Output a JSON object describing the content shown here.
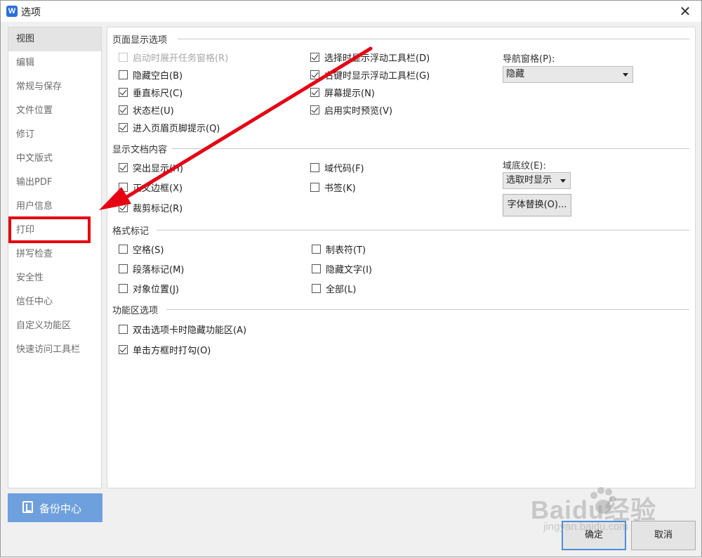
{
  "window": {
    "app_icon": "W",
    "title": "选项",
    "close_glyph": "✕"
  },
  "sidebar": {
    "items": [
      {
        "label": "视图"
      },
      {
        "label": "编辑"
      },
      {
        "label": "常规与保存"
      },
      {
        "label": "文件位置"
      },
      {
        "label": "修订"
      },
      {
        "label": "中文版式"
      },
      {
        "label": "输出PDF"
      },
      {
        "label": "用户信息"
      },
      {
        "label": "打印"
      },
      {
        "label": "拼写检查"
      },
      {
        "label": "安全性"
      },
      {
        "label": "信任中心"
      },
      {
        "label": "自定义功能区"
      },
      {
        "label": "快速访问工具栏"
      }
    ],
    "selected": "视图",
    "highlighted": "打印",
    "backup_button": "备份中心"
  },
  "page_display": {
    "title": "页面显示选项",
    "options": [
      {
        "label": "启动时展开任务窗格(R)",
        "checked": false,
        "disabled": true
      },
      {
        "label": "隐藏空白(B)",
        "checked": false
      },
      {
        "label": "垂直标尺(C)",
        "checked": true
      },
      {
        "label": "状态栏(U)",
        "checked": true
      },
      {
        "label": "进入页眉页脚提示(Q)",
        "checked": true
      },
      {
        "label": "选择时显示浮动工具栏(D)",
        "checked": true
      },
      {
        "label": "右键时显示浮动工具栏(G)",
        "checked": true
      },
      {
        "label": "屏幕提示(N)",
        "checked": true
      },
      {
        "label": "启用实时预览(V)",
        "checked": true
      }
    ],
    "nav_pane_label": "导航窗格(P):",
    "nav_pane_value": "隐藏"
  },
  "doc_content": {
    "title": "显示文档内容",
    "options": [
      {
        "label": "突出显示(H)",
        "checked": true
      },
      {
        "label": "正文边框(X)",
        "checked": false
      },
      {
        "label": "裁剪标记(R)",
        "checked": true
      },
      {
        "label": "域代码(F)",
        "checked": false
      },
      {
        "label": "书签(K)",
        "checked": false
      }
    ],
    "field_shading_label": "域底纹(E):",
    "field_shading_value": "选取时显示",
    "font_sub_button": "字体替换(O)..."
  },
  "format_marks": {
    "title": "格式标记",
    "options": [
      {
        "label": "空格(S)",
        "checked": false
      },
      {
        "label": "段落标记(M)",
        "checked": false
      },
      {
        "label": "对象位置(J)",
        "checked": false
      },
      {
        "label": "制表符(T)",
        "checked": false
      },
      {
        "label": "隐藏文字(I)",
        "checked": false
      },
      {
        "label": "全部(L)",
        "checked": false
      }
    ]
  },
  "ribbon": {
    "title": "功能区选项",
    "options": [
      {
        "label": "双击选项卡时隐藏功能区(A)",
        "checked": false
      },
      {
        "label": "单击方框时打勾(O)",
        "checked": true
      }
    ]
  },
  "footer": {
    "ok": "确定",
    "cancel": "取消"
  },
  "watermark": {
    "main": "Baidu经验",
    "sub": "jingyan.baidu.com"
  },
  "colors": {
    "annotation_red": "#e60012",
    "backup_blue": "#6ea0de",
    "ok_border": "#4a90d9"
  }
}
